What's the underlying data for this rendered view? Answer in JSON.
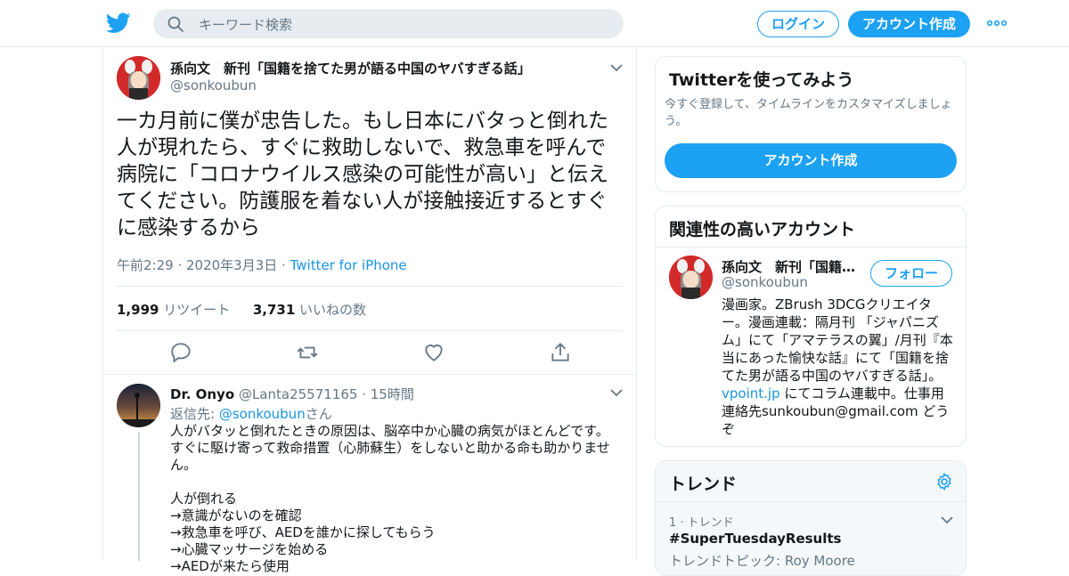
{
  "header": {
    "search_placeholder": "キーワード検索",
    "login_label": "ログイン",
    "signup_label": "アカウント作成",
    "brand_color": "#1da1f2"
  },
  "tweet": {
    "author_name": "孫向文　新刊「国籍を捨てた男が語る中国のヤバすぎる話」",
    "author_handle": "@sonkoubun",
    "text": "一カ月前に僕が忠告した。もし日本にバタっと倒れた人が現れたら、すぐに救助しないで、救急車を呼んで病院に「コロナウイルス感染の可能性が高い」と伝えてください。防護服を着ない人が接触接近するとすぐに感染するから",
    "time": "午前2:29 · 2020年3月3日",
    "dot": "·",
    "source": "Twitter for iPhone",
    "retweets_count": "1,999",
    "retweets_label": "リツイート",
    "likes_count": "3,731",
    "likes_label": "いいねの数",
    "actions": [
      "reply-icon",
      "retweet-icon",
      "like-icon",
      "share-icon"
    ]
  },
  "reply": {
    "author_name": "Dr. Onyo",
    "author_handle": "@Lanta25571165",
    "time": "· 15時間",
    "replying_prefix": "返信先: ",
    "replying_to": "@sonkoubun",
    "replying_suffix": "さん",
    "lines": [
      "人がバタッと倒れたときの原因は、脳卒中か心臓の病気がほとんどです。すぐに駆け寄って救命措置（心肺蘇生）をしないと助かる命も助かりません。",
      "",
      "人が倒れる",
      "→意識がないのを確認",
      "→救急車を呼び、AEDを誰かに探してもらう",
      "→心臓マッサージを始める",
      "→AEDが来たら使用"
    ]
  },
  "promo_card": {
    "title": "Twitterを使ってみよう",
    "subtitle": "今すぐ登録して、タイムラインをカスタマイズしましょう。",
    "button_label": "アカウント作成"
  },
  "related_card": {
    "title": "関連性の高いアカウント",
    "name": "孫向文　新刊「国籍…",
    "handle": "@sonkoubun",
    "follow_label": "フォロー",
    "bio_before": "漫画家。ZBrush 3DCGクリエイター。漫画連載：隔月刊 「ジャパニズム」にて「アマテラスの翼」/月刊『本当にあった愉快な話』にて「国籍を捨てた男が語る中国のヤバすぎる話」。",
    "bio_link": "vpoint.jp",
    "bio_after": " にてコラム連載中。仕事用連絡先sunkoubun@gmail.com どうぞ"
  },
  "trends_card": {
    "title": "トレンド",
    "items": [
      {
        "rank": "1 · トレンド",
        "name": "#SuperTuesdayResults",
        "topic": "トレンドトピック: Roy Moore"
      }
    ]
  }
}
